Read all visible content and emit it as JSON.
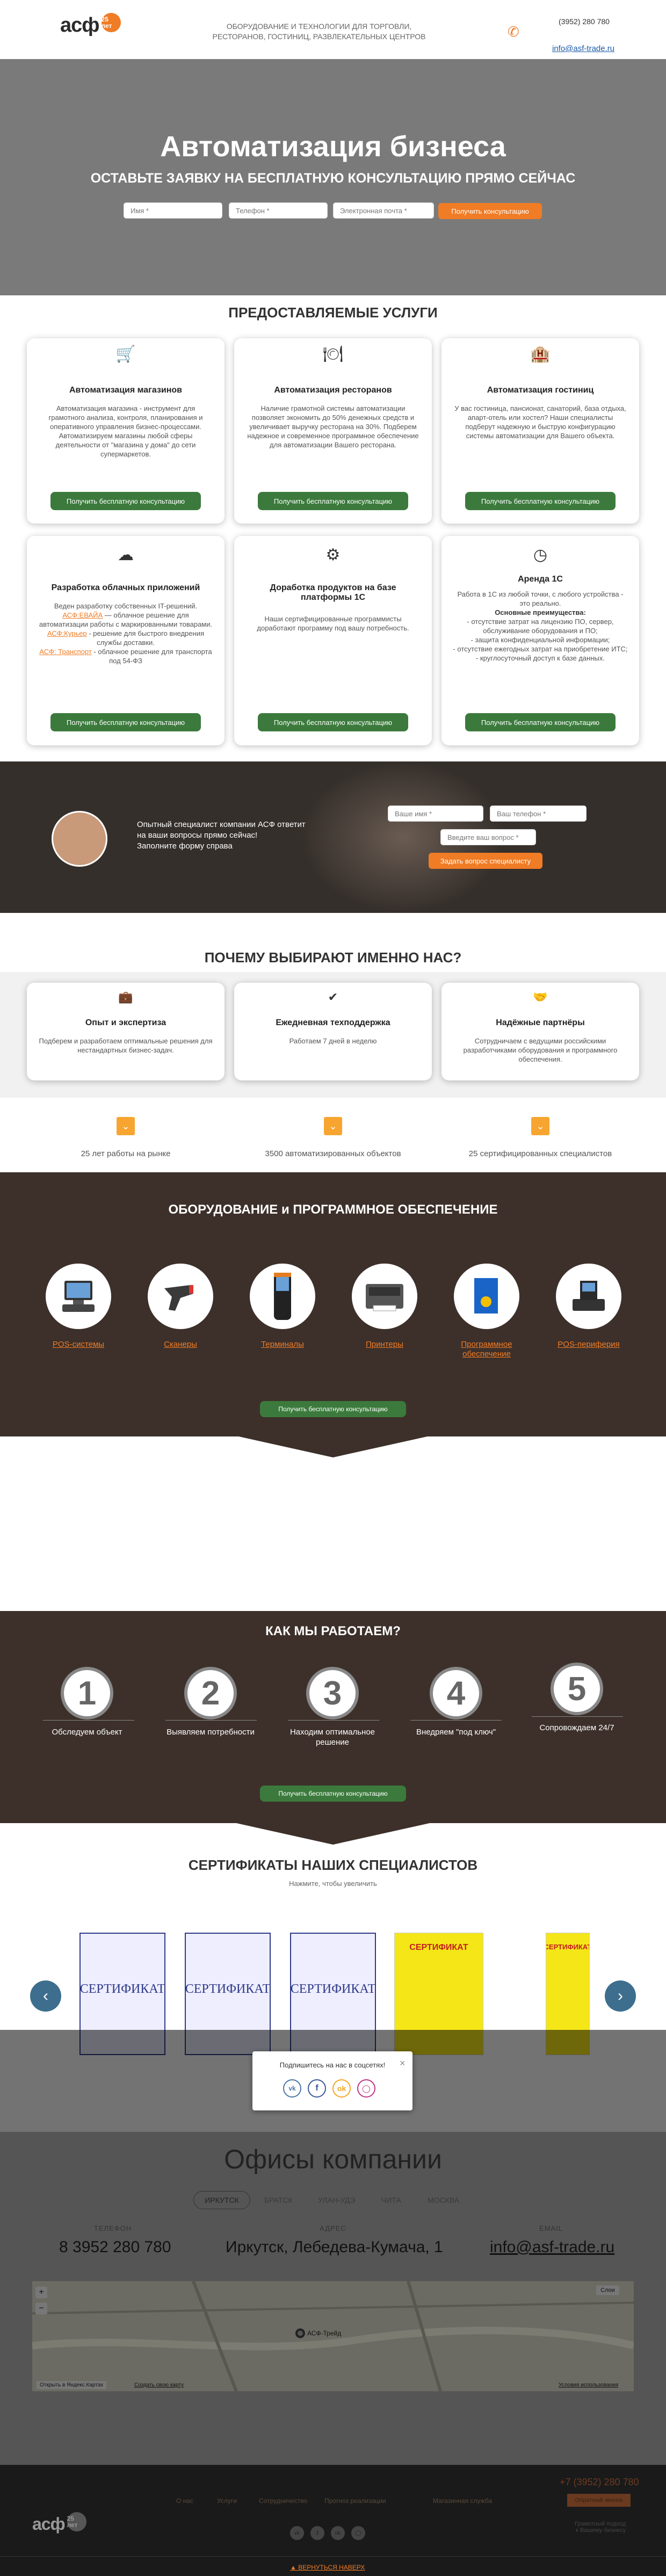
{
  "header": {
    "logo_text": "асф",
    "logo_badge": "25 лет",
    "tagline_line1": "ОБОРУДОВАНИЕ И ТЕХНОЛОГИИ ДЛЯ ТОРГОВЛИ,",
    "tagline_line2": "РЕСТОРАНОВ, ГОСТИНИЦ, РАЗВЛЕКАТЕЛЬНЫХ ЦЕНТРОВ",
    "phone": "(3952) 280 780",
    "email": "info@asf-trade.ru"
  },
  "hero": {
    "title": "Автоматизация бизнеса",
    "subtitle": "ОСТАВЬТЕ ЗАЯВКУ НА БЕСПЛАТНУЮ КОНСУЛЬТАЦИЮ ПРЯМО СЕЙЧАС",
    "name_placeholder": "Имя *",
    "phone_placeholder": "Телефон *",
    "email_placeholder": "Электронная почта *",
    "button": "Получить консультацию"
  },
  "services": {
    "title": "ПРЕДОСТАВЛЯЕМЫЕ УСЛУГИ",
    "cta": "Получить бесплатную консультацию",
    "cards": [
      {
        "icon": "basket-icon",
        "title": "Автоматизация магазинов",
        "text": "Автоматизация магазина - инструмент для грамотного анализа, контроля, планирования и оперативного управления бизнес-процессами. Автоматизируем магазины любой сферы деятельности от \"магазина у дома\" до сети супермаркетов."
      },
      {
        "icon": "cloche-icon",
        "title": "Автоматизация ресторанов",
        "text": "Наличие грамотной системы автоматизации позволяет экономить до 50% денежных средств и увеличивает выручку ресторана на 30%. Подберем надежное и современное программное обеспечение для автоматизации Вашего ресторана."
      },
      {
        "icon": "hotel-icon",
        "title": "Автоматизация гостиниц",
        "text": "У вас гостиница, пансионат, санаторий, база отдыха, апарт-отель или хостел? Наши специалисты подберут надежную и быструю конфигурацию системы автоматизации для Вашего объекта."
      },
      {
        "icon": "cloud-icon",
        "title": "Разработка облачных приложений",
        "text_parts": [
          "Веден разработку собственных IT-решений.",
          "АСФ:ЕВАЙА",
          " — облачное решение для автоматизации работы с маркированными товарами.",
          "АСФ:Курьер",
          " - решение для быстрого внедрения службы доставки.",
          "АСФ: Транспорт",
          " - облачное решение для транспорта под 54-ФЗ"
        ]
      },
      {
        "icon": "gears-icon",
        "title": "Доработка продуктов на базе платформы 1С",
        "text": "Наши сертифицированные программисты доработают программу под вашу потребность."
      },
      {
        "icon": "lease-icon",
        "title": "Аренда 1С",
        "text_intro": "Работа в 1С из любой точки, с любого устройства - это реально.",
        "advantages_title": "Основные преимущества:",
        "advantages": [
          "- отсутствие затрат на лицензию ПО, сервер, обслуживание оборудования и ПО;",
          "- защита конфиденциальной информации;",
          "- отсутствие ежегодных затрат на приобретение ИТС;",
          "- круглосуточный доступ к базе данных."
        ]
      }
    ]
  },
  "consult": {
    "text_line1": "Опытный специалист компании АСФ ответит",
    "text_line2": "на ваши вопросы прямо сейчас!",
    "text_line3": "Заполните форму справа",
    "name_placeholder": "Ваше имя *",
    "phone_placeholder": "Ваш телефон *",
    "question_placeholder": "Введите ваш вопрос *",
    "button": "Задать вопрос специалисту"
  },
  "why": {
    "title": "ПОЧЕМУ ВЫБИРАЮТ ИМЕННО НАС?",
    "cards": [
      {
        "icon": "briefcase-icon",
        "title": "Опыт и экспертиза",
        "text": "Подберем и разработаем оптимальные решения для нестандартных бизнес-задач."
      },
      {
        "icon": "check-icon",
        "title": "Ежедневная техподдержка",
        "text": "Работаем 7 дней в неделю"
      },
      {
        "icon": "partners-icon",
        "title": "Надёжные партнёры",
        "text": "Сотрудничаем с ведущими российскими разработчиками оборудования и программного обеспечения."
      }
    ],
    "stats": [
      "25 лет работы на рынке",
      "3500 автоматизированных объектов",
      "25 сертифицированных специалистов"
    ]
  },
  "equipment": {
    "title": "ОБОРУДОВАНИЕ и ПРОГРАММНОЕ ОБЕСПЕЧЕНИЕ",
    "items": [
      {
        "icon": "pos-terminal-icon",
        "label": "POS-системы"
      },
      {
        "icon": "scanner-icon",
        "label": "Сканеры"
      },
      {
        "icon": "data-terminal-icon",
        "label": "Терминалы"
      },
      {
        "icon": "printer-icon",
        "label": "Принтеры"
      },
      {
        "icon": "software-box-icon",
        "label": "Программное обеспечение"
      },
      {
        "icon": "pos-peripheral-icon",
        "label": "POS-периферия"
      }
    ],
    "cta": "Получить бесплатную консультацию"
  },
  "how": {
    "title": "КАК МЫ РАБОТАЕМ?",
    "steps": [
      {
        "num": "1",
        "label": "Обследуем объект"
      },
      {
        "num": "2",
        "label": "Выявляем потребности"
      },
      {
        "num": "3",
        "label": "Находим оптимальное решение"
      },
      {
        "num": "4",
        "label": "Внедряем \"под ключ\""
      },
      {
        "num": "5",
        "label": "Сопровождаем 24/7"
      }
    ],
    "cta": "Получить бесплатную консультацию"
  },
  "certificates": {
    "title": "СЕРТИФИКАТЫ НАШИХ СПЕЦИАЛИСТОВ",
    "subtitle": "Нажмите, чтобы увеличить",
    "items": [
      "СЕРТИФИКАТ",
      "СЕРТИФИКАТ",
      "СЕРТИФИКАТ",
      "СЕРТИФИКАТ",
      "СЕРТИФИКАТ"
    ]
  },
  "social_popup": {
    "text": "Подпишитесь на нас в соцсетях!",
    "close": "×",
    "icons": [
      "vk-icon",
      "facebook-icon",
      "odnoklassniki-icon",
      "instagram-icon"
    ]
  },
  "offices": {
    "title": "Офисы компании",
    "tabs": [
      "ИРКУТСК",
      "БРАТСК",
      "УЛАН-УДЭ",
      "ЧИТА",
      "МОСКВА"
    ],
    "phone_label": "ТЕЛЕФОН",
    "phone": "8 3952 280 780",
    "address_label": "АДРЕС",
    "address": "Иркутск, Лебедева-Кумача, 1",
    "email_label": "EMAIL",
    "email": "info@asf-trade.ru",
    "map_pin": "АСФ-Трейд",
    "map_open": "Открыть в Яндекс.Картах",
    "map_create": "Создать свою карту",
    "map_layers": "Слои",
    "map_terms": "Условия использования"
  },
  "footer": {
    "links": [
      "О нас",
      "Услуги",
      "Сотрудничество",
      "Прогноз реализации",
      "Магазинная служба"
    ],
    "phone": "+7 (3952) 280 780",
    "button": "Обратный звонок",
    "note_line1": "Грамотный подход",
    "note_line2": "к Вашему бизнесу",
    "back_to_top": "ВЕРНУТЬСЯ НАВЕРХ"
  }
}
